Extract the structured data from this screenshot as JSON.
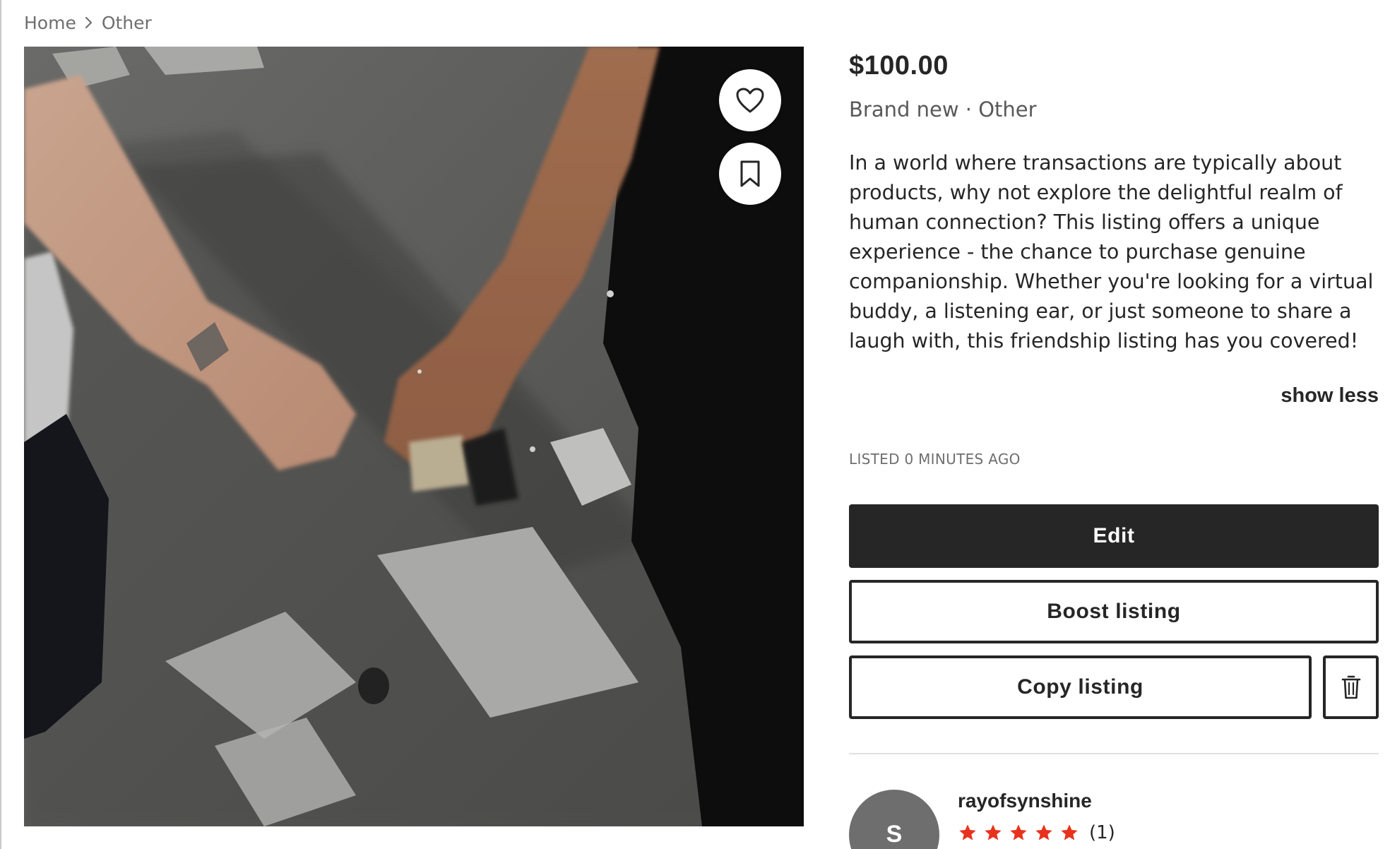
{
  "breadcrumb": {
    "items": [
      "Home",
      "Other"
    ]
  },
  "photo": {
    "like_icon": "heart-icon",
    "save_icon": "bookmark-icon"
  },
  "listing": {
    "price": "$100.00",
    "subline": "Brand new · Other",
    "description": "In a world where transactions are typically about products, why not explore the delightful realm of human connection? This listing offers a unique experience - the chance to purchase genuine companionship. Whether you're looking for a virtual buddy, a listening ear, or just someone to share a laugh with, this friendship listing has you covered!",
    "show_less_label": "show less",
    "listed_label": "LISTED 0 MINUTES AGO"
  },
  "actions": {
    "edit_label": "Edit",
    "boost_label": "Boost listing",
    "copy_label": "Copy listing",
    "delete_icon": "trash-icon"
  },
  "seller": {
    "avatar_initial": "S",
    "username": "rayofsynshine",
    "rating": 5,
    "rating_max": 5,
    "review_count": "(1)"
  },
  "colors": {
    "primary_dark": "#262626",
    "star_red": "#e8321e",
    "avatar_gray": "#6e6e6e",
    "muted_text": "#6f6f6f"
  }
}
